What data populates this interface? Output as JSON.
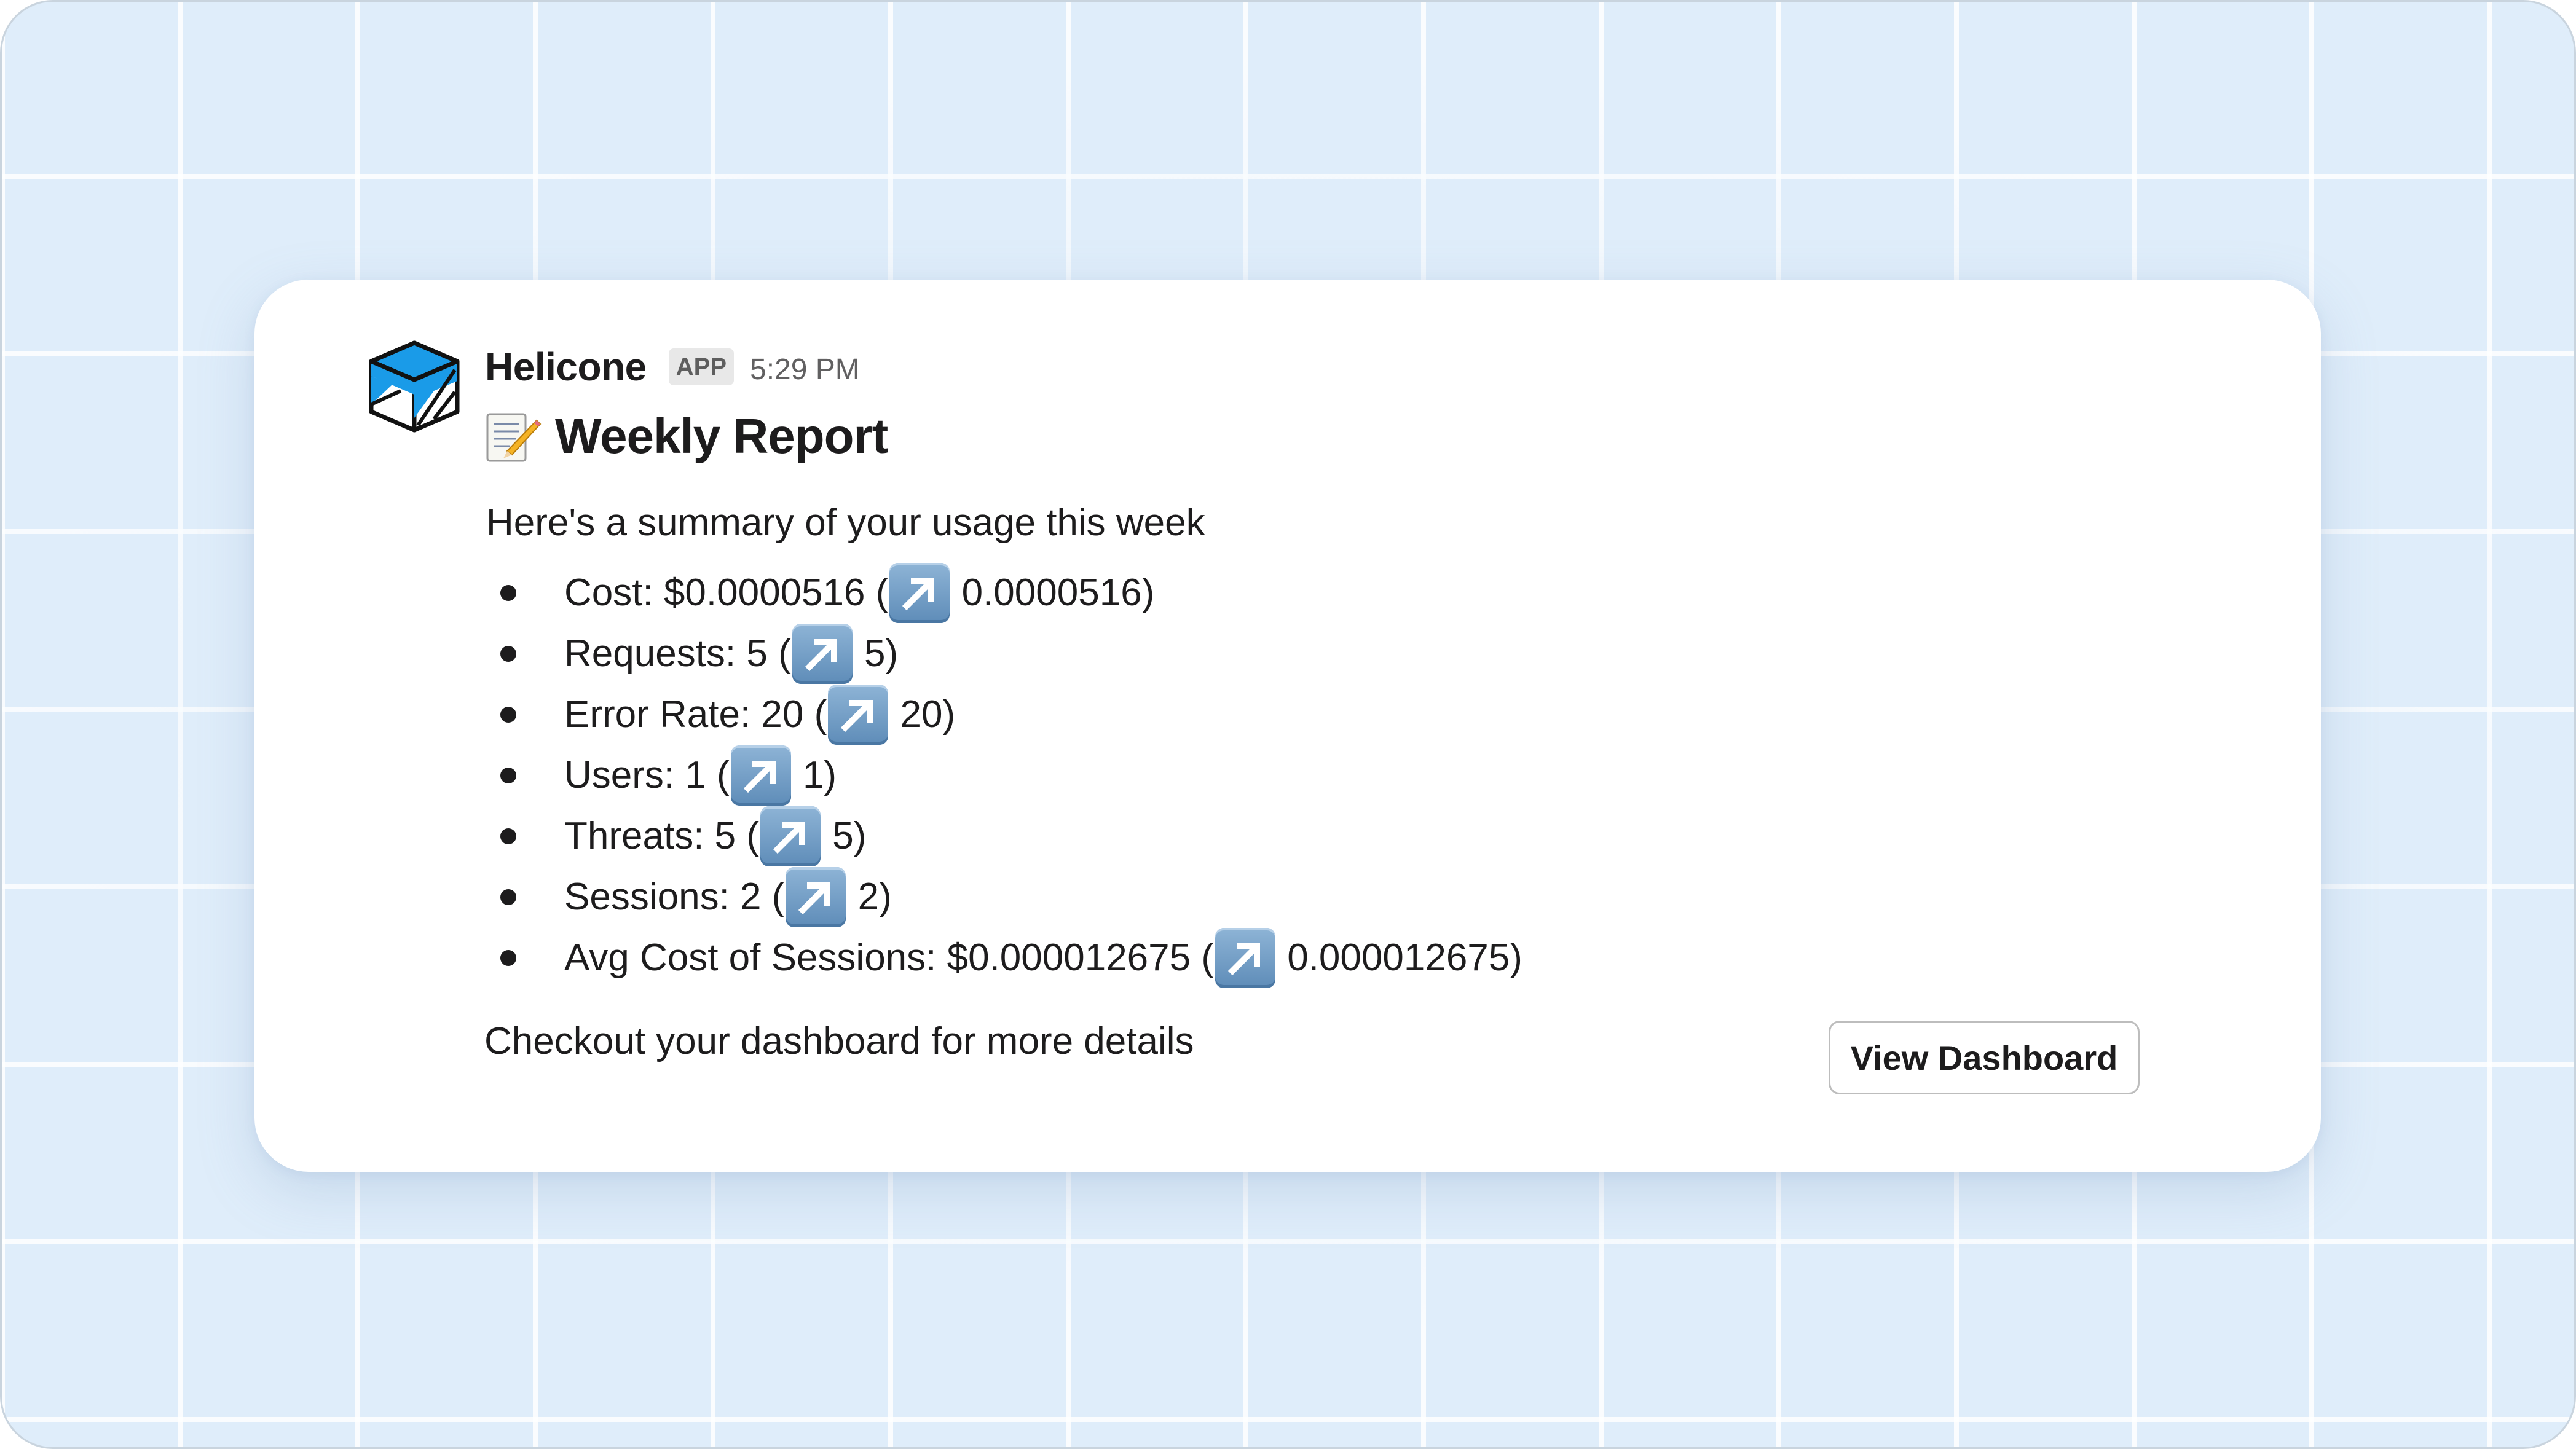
{
  "message": {
    "app_name": "Helicone",
    "app_badge": "APP",
    "timestamp": "5:29 PM",
    "title_icon": "memo-icon",
    "title": "Weekly Report",
    "summary": "Here's a summary of your usage this week",
    "trend_icon": "up-right-arrow-icon",
    "metrics": [
      {
        "label": "Cost: $0.0000516 (",
        "change": " 0.0000516)"
      },
      {
        "label": "Requests: 5 (",
        "change": " 5)"
      },
      {
        "label": "Error Rate: 20 (",
        "change": " 20)"
      },
      {
        "label": "Users: 1 (",
        "change": " 1)"
      },
      {
        "label": "Threats: 5 (",
        "change": " 5)"
      },
      {
        "label": "Sessions: 2 (",
        "change": " 2)"
      },
      {
        "label": "Avg Cost of Sessions: $0.000012675 (",
        "change": " 0.000012675)"
      }
    ],
    "footer_text": "Checkout your dashboard for more details",
    "button_label": "View Dashboard"
  },
  "colors": {
    "background": "#dfedfa",
    "card": "#ffffff",
    "text": "#1d1c1d",
    "logo_blue": "#1a9be8",
    "arrow_box": "#6b98c4"
  }
}
